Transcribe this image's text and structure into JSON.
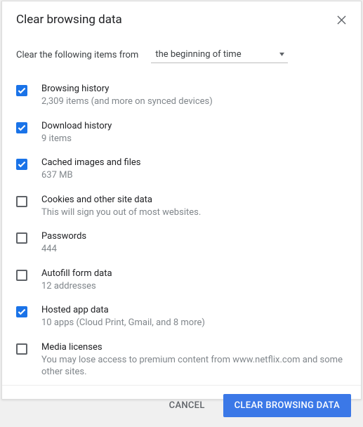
{
  "title": "Clear browsing data",
  "range": {
    "label": "Clear the following items from",
    "selected": "the beginning of time"
  },
  "items": [
    {
      "title": "Browsing history",
      "sub": "2,309 items (and more on synced devices)",
      "checked": true
    },
    {
      "title": "Download history",
      "sub": "9 items",
      "checked": true
    },
    {
      "title": "Cached images and files",
      "sub": "637 MB",
      "checked": true
    },
    {
      "title": "Cookies and other site data",
      "sub": "This will sign you out of most websites.",
      "checked": false
    },
    {
      "title": "Passwords",
      "sub": "444",
      "checked": false
    },
    {
      "title": "Autofill form data",
      "sub": "12 addresses",
      "checked": false
    },
    {
      "title": "Hosted app data",
      "sub": "10 apps (Cloud Print, Gmail, and 8 more)",
      "checked": true
    },
    {
      "title": "Media licenses",
      "sub": "You may lose access to premium content from www.netflix.com and some other sites.",
      "checked": false
    }
  ],
  "buttons": {
    "cancel": "CANCEL",
    "clear": "CLEAR BROWSING DATA"
  }
}
